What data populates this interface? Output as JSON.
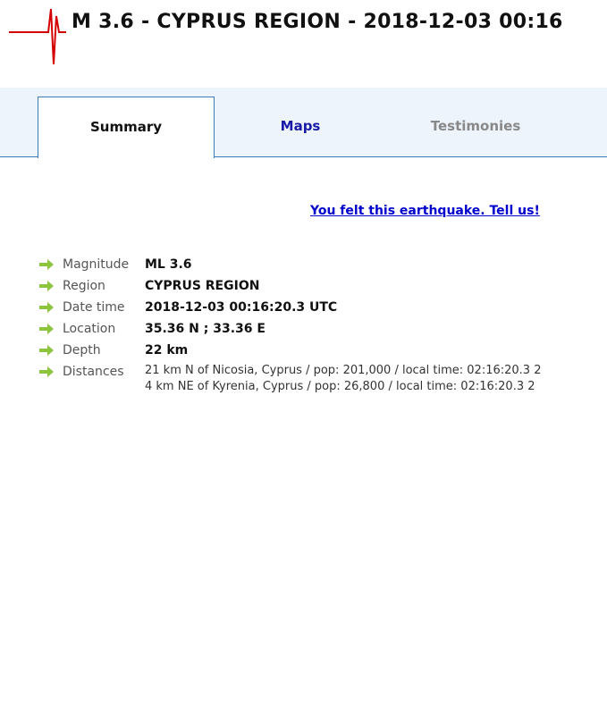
{
  "header": {
    "title": "M 3.6 - CYPRUS REGION - 2018-12-03 00:16"
  },
  "tabs": [
    {
      "label": "Summary",
      "state": "active"
    },
    {
      "label": "Maps",
      "state": "link"
    },
    {
      "label": "Testimonies",
      "state": "disabled"
    }
  ],
  "felt_link": "You felt this earthquake. Tell us!",
  "details": {
    "magnitude": {
      "label": "Magnitude",
      "value": "ML 3.6"
    },
    "region": {
      "label": "Region",
      "value": "CYPRUS REGION"
    },
    "datetime": {
      "label": "Date time",
      "value": "2018-12-03 00:16:20.3 UTC"
    },
    "location": {
      "label": "Location",
      "value": "35.36 N ; 33.36 E"
    },
    "depth": {
      "label": "Depth",
      "value": "22 km"
    },
    "distances": {
      "label": "Distances",
      "lines": [
        "21 km N of Nicosia, Cyprus / pop: 201,000 / local time: 02:16:20.3 2",
        "4 km NE of Kyrenia, Cyprus / pop: 26,800 / local time: 02:16:20.3 2"
      ]
    }
  },
  "colors": {
    "accent_blue": "#3c7ab8",
    "tabbar_bg": "#edf4fb",
    "link_blue": "#0000cc",
    "arrow_green": "#8cc63f",
    "logo_red": "#d40000"
  },
  "icons": {
    "logo": "seismogram-logo-icon",
    "bullet": "green-arrow-icon"
  }
}
